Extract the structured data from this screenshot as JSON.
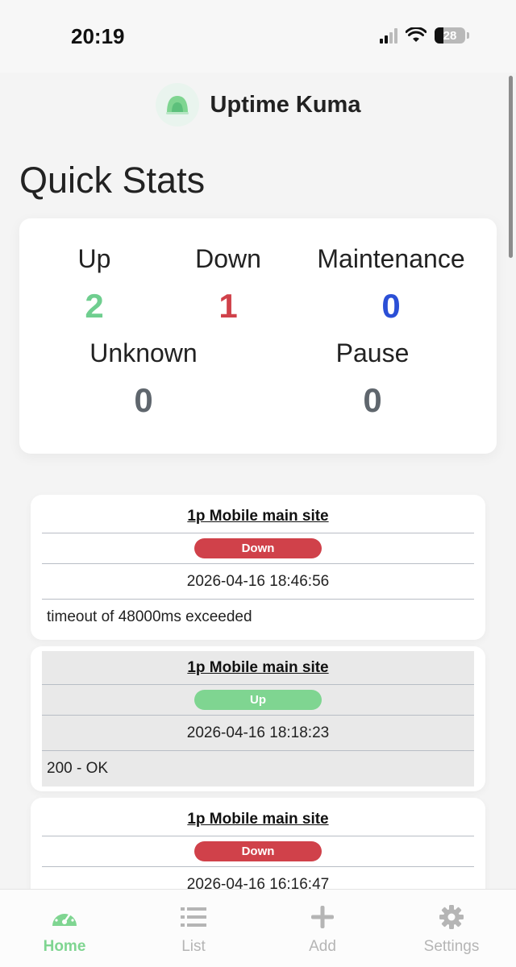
{
  "status_bar": {
    "time": "20:19",
    "battery": "28"
  },
  "brand": {
    "name": "Uptime Kuma"
  },
  "page_title": "Quick Stats",
  "stats": {
    "up": {
      "label": "Up",
      "value": "2"
    },
    "down": {
      "label": "Down",
      "value": "1"
    },
    "maintenance": {
      "label": "Maintenance",
      "value": "0"
    },
    "unknown": {
      "label": "Unknown",
      "value": "0"
    },
    "pause": {
      "label": "Pause",
      "value": "0"
    }
  },
  "beats": [
    {
      "monitor": "1p Mobile main site",
      "status": "Down",
      "time": "2026-04-16 18:46:56",
      "message": "timeout of 48000ms exceeded"
    },
    {
      "monitor": "1p Mobile main site",
      "status": "Up",
      "time": "2026-04-16 18:18:23",
      "message": "200 - OK"
    },
    {
      "monitor": "1p Mobile main site",
      "status": "Down",
      "time": "2026-04-16 16:16:47"
    }
  ],
  "tabs": [
    {
      "label": "Home",
      "icon": "speedometer-icon"
    },
    {
      "label": "List",
      "icon": "list-icon"
    },
    {
      "label": "Add",
      "icon": "plus-icon"
    },
    {
      "label": "Settings",
      "icon": "gear-icon"
    }
  ],
  "colors": {
    "up": "#6fce8f",
    "down": "#d0414a",
    "maintenance": "#2b4fd6",
    "neutral": "#5f666d",
    "accent": "#7fd591"
  }
}
